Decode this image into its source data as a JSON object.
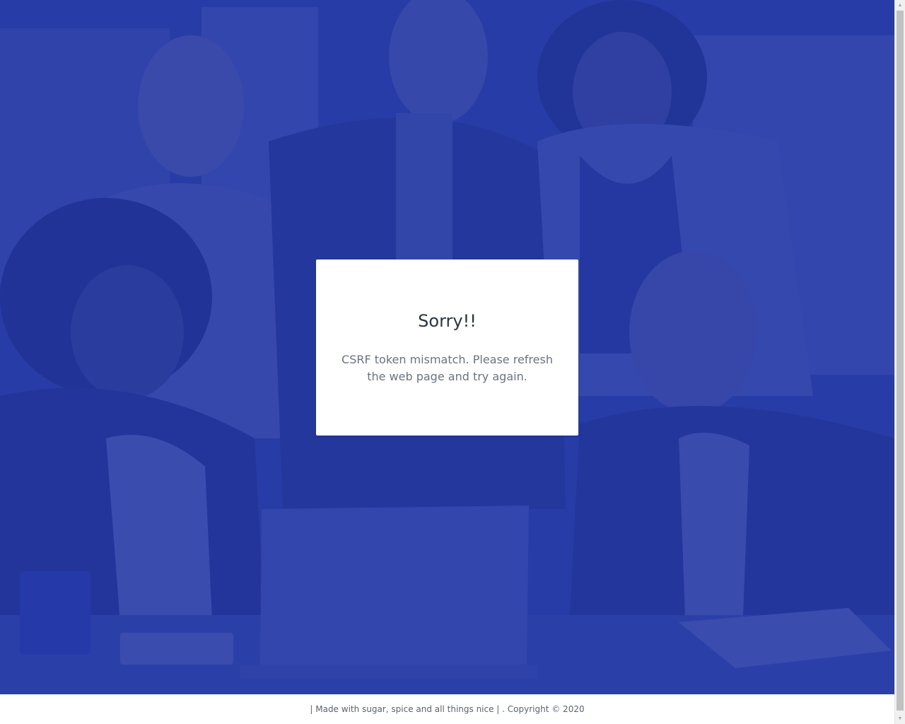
{
  "error_card": {
    "title": "Sorry!!",
    "message": "CSRF token mismatch. Please refresh the web page and try again."
  },
  "footer": {
    "text": "| Made with sugar, spice and all things nice | . Copyright © 2020"
  },
  "colors": {
    "overlay": "#2337a5",
    "card_background": "#ffffff",
    "title_text": "#2c3340",
    "message_text": "#6b7280"
  },
  "icons": {
    "scroll_up": "triangle-up-icon",
    "scroll_down": "triangle-down-icon"
  }
}
